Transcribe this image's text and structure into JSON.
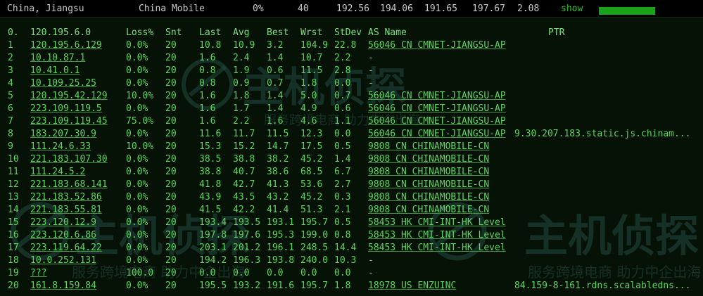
{
  "summary": {
    "location": "China, Jiangsu",
    "isp": "China Mobile",
    "loss": "0%",
    "sent": "40",
    "last": "192.56",
    "avg": "194.06",
    "best": "191.65",
    "worst": "197.67",
    "stdev": "2.08",
    "show_label": "show",
    "progress_fraction": 1.0
  },
  "watermark": {
    "brand": "主机侦探",
    "slogan": "服务跨境电商 助力中企出海"
  },
  "mtr": {
    "headers": {
      "hop": "0.",
      "host": "120.195.6.0",
      "loss": "Loss%",
      "snt": "Snt",
      "last": "Last",
      "avg": "Avg",
      "best": "Best",
      "wrst": "Wrst",
      "stdev": "StDev",
      "asname": "AS Name",
      "ptr": "PTR"
    },
    "rows": [
      {
        "hop": "1",
        "host": "120.195.6.129",
        "loss": "0.0%",
        "snt": "20",
        "last": "10.8",
        "avg": "10.9",
        "best": "3.2",
        "wrst": "104.9",
        "stdev": "22.8",
        "asname": "56046 CN CMNET-JIANGSU-AP",
        "ptr": ""
      },
      {
        "hop": "2",
        "host": "10.10.87.1",
        "loss": "0.0%",
        "snt": "20",
        "last": "1.6",
        "avg": "2.4",
        "best": "1.4",
        "wrst": "10.7",
        "stdev": "2.2",
        "asname": "-",
        "ptr": ""
      },
      {
        "hop": "3",
        "host": "10.41.0.1",
        "loss": "0.0%",
        "snt": "20",
        "last": "0.8",
        "avg": "1.9",
        "best": "0.6",
        "wrst": "11.5",
        "stdev": "2.8",
        "asname": "-",
        "ptr": ""
      },
      {
        "hop": "4",
        "host": "10.109.25.25",
        "loss": "0.0%",
        "snt": "20",
        "last": "0.8",
        "avg": "0.9",
        "best": "0.7",
        "wrst": "1.8",
        "stdev": "0.0",
        "asname": "-",
        "ptr": ""
      },
      {
        "hop": "5",
        "host": "120.195.42.129",
        "loss": "10.0%",
        "snt": "20",
        "last": "1.6",
        "avg": "1.8",
        "best": "1.4",
        "wrst": "5.0",
        "stdev": "0.7",
        "asname": "56046 CN CMNET-JIANGSU-AP",
        "ptr": ""
      },
      {
        "hop": "6",
        "host": "223.109.119.5",
        "loss": "0.0%",
        "snt": "20",
        "last": "1.6",
        "avg": "1.7",
        "best": "1.4",
        "wrst": "4.9",
        "stdev": "0.6",
        "asname": "56046 CN CMNET-JIANGSU-AP",
        "ptr": ""
      },
      {
        "hop": "7",
        "host": "223.109.119.45",
        "loss": "75.0%",
        "snt": "20",
        "last": "1.6",
        "avg": "2.2",
        "best": "1.6",
        "wrst": "4.6",
        "stdev": "1.1",
        "asname": "56046 CN CMNET-JIANGSU-AP",
        "ptr": ""
      },
      {
        "hop": "8",
        "host": "183.207.30.9",
        "loss": "0.0%",
        "snt": "20",
        "last": "11.6",
        "avg": "11.7",
        "best": "11.5",
        "wrst": "12.3",
        "stdev": "0.0",
        "asname": "56046 CN CMNET-JIANGSU-AP",
        "ptr": "9.30.207.183.static.js.chinam..."
      },
      {
        "hop": "9",
        "host": "111.24.6.33",
        "loss": "10.0%",
        "snt": "20",
        "last": "15.3",
        "avg": "15.2",
        "best": "14.7",
        "wrst": "17.5",
        "stdev": "0.5",
        "asname": "9808 CN CHINAMOBILE-CN",
        "ptr": ""
      },
      {
        "hop": "10",
        "host": "221.183.107.30",
        "loss": "0.0%",
        "snt": "20",
        "last": "38.5",
        "avg": "38.8",
        "best": "38.2",
        "wrst": "45.2",
        "stdev": "1.4",
        "asname": "9808 CN CHINAMOBILE-CN",
        "ptr": ""
      },
      {
        "hop": "11",
        "host": "111.24.5.2",
        "loss": "0.0%",
        "snt": "20",
        "last": "38.8",
        "avg": "40.7",
        "best": "38.6",
        "wrst": "68.5",
        "stdev": "6.7",
        "asname": "9808 CN CHINAMOBILE-CN",
        "ptr": ""
      },
      {
        "hop": "12",
        "host": "221.183.68.141",
        "loss": "0.0%",
        "snt": "20",
        "last": "41.8",
        "avg": "42.7",
        "best": "41.3",
        "wrst": "53.6",
        "stdev": "2.7",
        "asname": "9808 CN CHINAMOBILE-CN",
        "ptr": ""
      },
      {
        "hop": "13",
        "host": "221.183.52.86",
        "loss": "0.0%",
        "snt": "20",
        "last": "43.9",
        "avg": "43.5",
        "best": "43.2",
        "wrst": "45.2",
        "stdev": "0.3",
        "asname": "9808 CN CHINAMOBILE-CN",
        "ptr": ""
      },
      {
        "hop": "14",
        "host": "221.183.55.81",
        "loss": "0.0%",
        "snt": "20",
        "last": "41.5",
        "avg": "42.2",
        "best": "41.4",
        "wrst": "51.3",
        "stdev": "2.1",
        "asname": "9808 CN CHINAMOBILE-CN",
        "ptr": ""
      },
      {
        "hop": "15",
        "host": "223.120.12.9",
        "loss": "0.0%",
        "snt": "20",
        "last": "193.4",
        "avg": "193.5",
        "best": "193.1",
        "wrst": "195.7",
        "stdev": "0.5",
        "asname": "58453 HK CMI-INT-HK Level",
        "ptr": ""
      },
      {
        "hop": "16",
        "host": "223.120.6.86",
        "loss": "0.0%",
        "snt": "20",
        "last": "197.8",
        "avg": "197.6",
        "best": "195.3",
        "wrst": "199.0",
        "stdev": "0.8",
        "asname": "58453 HK CMI-INT-HK Level",
        "ptr": ""
      },
      {
        "hop": "17",
        "host": "223.119.64.22",
        "loss": "0.0%",
        "snt": "20",
        "last": "203.1",
        "avg": "201.2",
        "best": "196.1",
        "wrst": "248.5",
        "stdev": "14.4",
        "asname": "58453 HK CMI-INT-HK Level",
        "ptr": ""
      },
      {
        "hop": "18",
        "host": "10.0.252.131",
        "loss": "0.0%",
        "snt": "20",
        "last": "194.2",
        "avg": "196.3",
        "best": "193.8",
        "wrst": "240.0",
        "stdev": "10.3",
        "asname": "-",
        "ptr": ""
      },
      {
        "hop": "19",
        "host": "???",
        "loss": "100.0",
        "snt": "20",
        "last": "0.0",
        "avg": "0.0",
        "best": "0.0",
        "wrst": "0.0",
        "stdev": "0.0",
        "asname": "-",
        "ptr": ""
      },
      {
        "hop": "20",
        "host": "161.8.159.84",
        "loss": "0.0%",
        "snt": "20",
        "last": "195.5",
        "avg": "193.2",
        "best": "191.6",
        "wrst": "195.7",
        "stdev": "1.8",
        "asname": "18978 US ENZUINC",
        "ptr": "84.159-8-161.rdns.scalabledns..."
      }
    ]
  }
}
